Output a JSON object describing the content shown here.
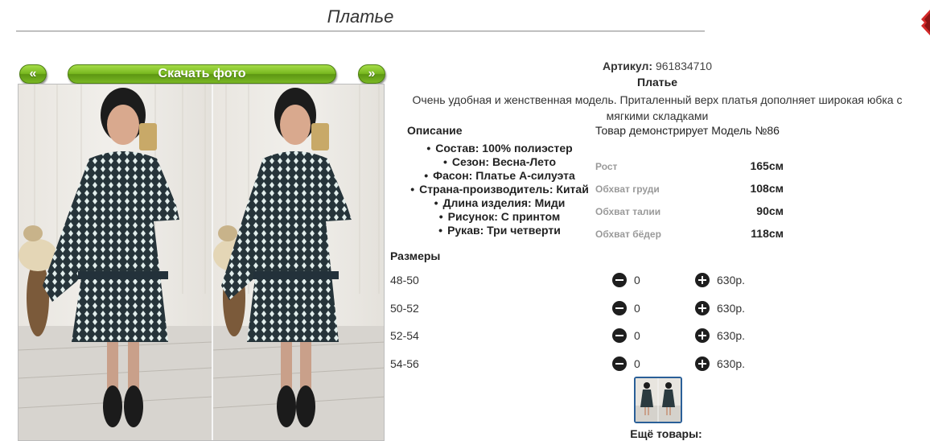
{
  "page": {
    "title": "Платье"
  },
  "photo_nav": {
    "prev_label": "«",
    "download_label": "Скачать фото",
    "next_label": "»"
  },
  "product": {
    "article_label": "Артикул:",
    "article_value": "961834710",
    "name": "Платье",
    "description": "Очень удобная и женственная модель. Приталенный верх платья дополняет широкая юбка с мягкими складками"
  },
  "specs": {
    "heading": "Описание",
    "items": [
      "Состав: 100% полиэстер",
      "Сезон: Весна-Лето",
      "Фасон: Платье А-силуэта",
      "Страна-производитель: Китай",
      "Длина изделия: Миди",
      "Рисунок: С принтом",
      "Рукав: Три четверти"
    ]
  },
  "model": {
    "note": "Товар демонстрирует Модель №86",
    "measurements": [
      {
        "label": "Рост",
        "value": "165см"
      },
      {
        "label": "Обхват груди",
        "value": "108см"
      },
      {
        "label": "Обхват талии",
        "value": "90см"
      },
      {
        "label": "Обхват бёдер",
        "value": "118см"
      }
    ]
  },
  "sizes": {
    "heading": "Размеры",
    "rows": [
      {
        "size": "48-50",
        "qty": "0",
        "price": "630р."
      },
      {
        "size": "50-52",
        "qty": "0",
        "price": "630р."
      },
      {
        "size": "52-54",
        "qty": "0",
        "price": "630р."
      },
      {
        "size": "54-56",
        "qty": "0",
        "price": "630р."
      }
    ]
  },
  "more": {
    "title": "Ещё товары:"
  },
  "colors": {
    "button_green": "#78b81f",
    "dress": "#2b3a3f",
    "dot": "#e6f0ee",
    "thumb_border": "#2a5f98",
    "corner_red": "#d42a2a"
  }
}
